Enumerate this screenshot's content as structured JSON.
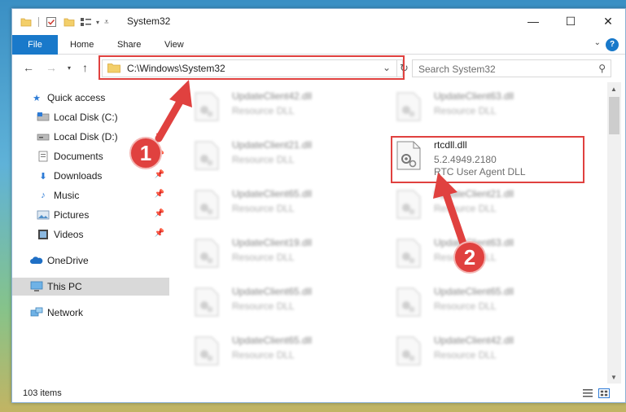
{
  "window": {
    "title": "System32",
    "controls": {
      "minimize": "—",
      "maximize": "☐",
      "close": "✕"
    }
  },
  "ribbon": {
    "tabs": [
      "File",
      "Home",
      "Share",
      "View"
    ],
    "help": "?"
  },
  "nav": {
    "address": "C:\\Windows\\System32",
    "search_placeholder": "Search System32"
  },
  "sidebar": {
    "items": [
      {
        "label": "Quick access",
        "icon": "star-icon",
        "pinned": false
      },
      {
        "label": "Local Disk (C:)",
        "icon": "drive-icon",
        "pinned": false
      },
      {
        "label": "Local Disk (D:)",
        "icon": "drive-icon",
        "pinned": true
      },
      {
        "label": "Documents",
        "icon": "documents-icon",
        "pinned": true
      },
      {
        "label": "Downloads",
        "icon": "download-icon",
        "pinned": true
      },
      {
        "label": "Music",
        "icon": "music-icon",
        "pinned": true
      },
      {
        "label": "Pictures",
        "icon": "pictures-icon",
        "pinned": true
      },
      {
        "label": "Videos",
        "icon": "videos-icon",
        "pinned": true
      },
      {
        "label": "OneDrive",
        "icon": "cloud-icon",
        "pinned": false
      },
      {
        "label": "This PC",
        "icon": "computer-icon",
        "pinned": false
      },
      {
        "label": "Network",
        "icon": "network-icon",
        "pinned": false
      }
    ]
  },
  "files": {
    "left": [
      {
        "name": "UpdateClient42.dll",
        "type": "Resource DLL"
      },
      {
        "name": "UpdateClient21.dll",
        "type": "Resource DLL"
      },
      {
        "name": "UpdateClient65.dll",
        "type": "Resource DLL"
      },
      {
        "name": "UpdateClient19.dll",
        "type": "Resource DLL"
      },
      {
        "name": "UpdateClient65.dll",
        "type": "Resource DLL"
      },
      {
        "name": "UpdateClient65.dll",
        "type": "Resource DLL"
      }
    ],
    "right": [
      {
        "name": "UpdateClient63.dll",
        "type": "Resource DLL"
      },
      {
        "name": "UpdateClient21.dll",
        "type": "Resource DLL"
      },
      {
        "name": "UpdateClient63.dll",
        "type": "Resource DLL"
      },
      {
        "name": "UpdateClient65.dll",
        "type": "Resource DLL"
      },
      {
        "name": "UpdateClient42.dll",
        "type": "Resource DLL"
      }
    ],
    "highlighted": {
      "name": "rtcdll.dll",
      "version": "5.2.4949.2180",
      "description": "RTC User Agent DLL"
    }
  },
  "status": {
    "item_count": "103 items"
  },
  "annotations": {
    "step1": "1",
    "step2": "2",
    "color": "#e0413f"
  },
  "colors": {
    "accent": "#1979ca",
    "selection": "#d9d9d9"
  }
}
